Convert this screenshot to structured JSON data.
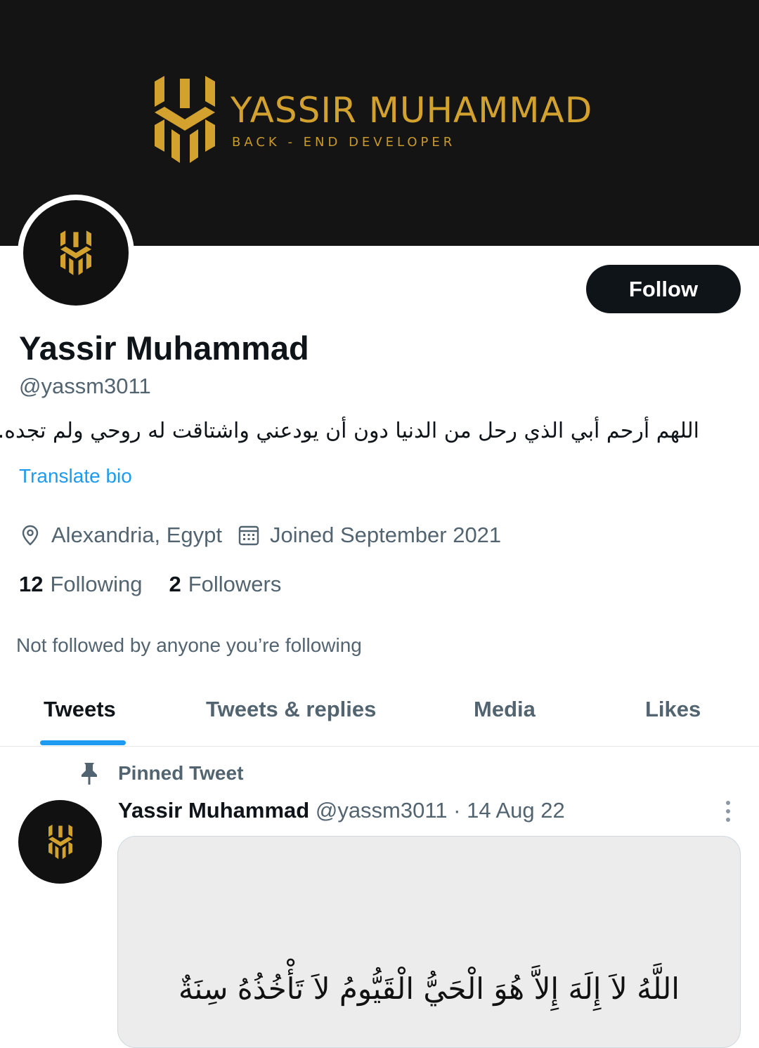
{
  "banner": {
    "title": "YASSIR MUHAMMAD",
    "subtitle": "BACK - END DEVELOPER",
    "brand_color": "#d3a22e"
  },
  "profile": {
    "follow_label": "Follow",
    "name": "Yassir Muhammad",
    "handle": "@yassm3011",
    "bio": "اللهم أرحم أبي الذي رحل من الدنيا دون أن يودعني واشتاقت له روحي ولم تجده.",
    "translate_label": "Translate bio",
    "location_icon": "location-pin-icon",
    "location": "Alexandria, Egypt",
    "joined_icon": "calendar-icon",
    "joined": "Joined September 2021",
    "following_count": "12",
    "following_label": "Following",
    "followers_count": "2",
    "followers_label": "Followers",
    "not_followed_text": "Not followed by anyone you’re following"
  },
  "tabs": [
    {
      "label": "Tweets",
      "active": true
    },
    {
      "label": "Tweets & replies",
      "active": false
    },
    {
      "label": "Media",
      "active": false
    },
    {
      "label": "Likes",
      "active": false
    }
  ],
  "accent_color": "#1d9bf0",
  "pinned_tweet": {
    "pinned_label": "Pinned Tweet",
    "author_name": "Yassir Muhammad",
    "author_handle": "@yassm3011",
    "date": "· 14 Aug 22",
    "media_text": "اللَّهُ لاَ إِلَهَ إِلاَّ هُوَ الْحَيُّ الْقَيُّومُ لاَ تَأْخُذُهُ سِنَةٌ"
  }
}
